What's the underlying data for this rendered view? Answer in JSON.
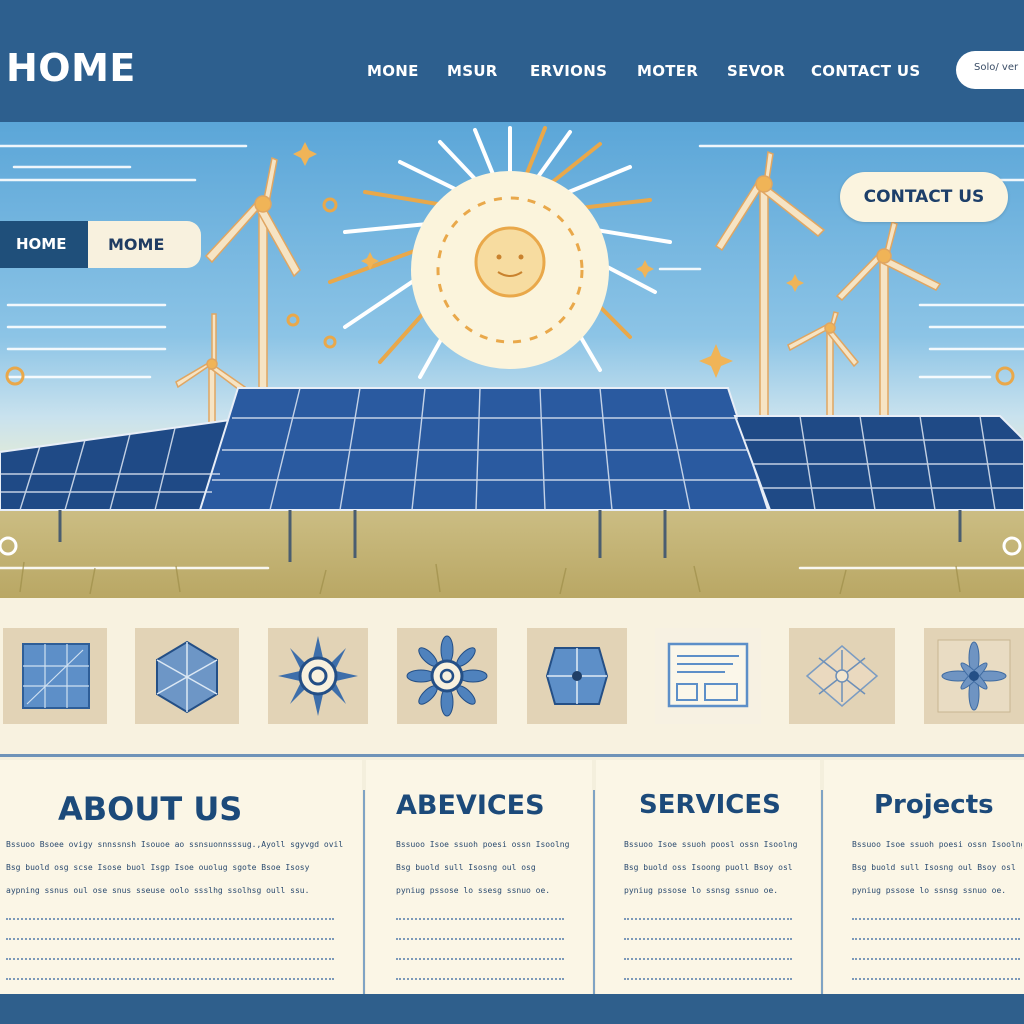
{
  "header": {
    "logo": "HOME",
    "nav": [
      "MONE",
      "MSUR",
      "ERVIONS",
      "MOTER",
      "SEVOR",
      "CONTACT US"
    ],
    "search_placeholder": "Solo/ ver"
  },
  "hero": {
    "breadcrumb": {
      "home": "HOME",
      "current": "MOME"
    },
    "cta": "CONTACT US"
  },
  "features": [
    {
      "icon": "solar-grid-icon"
    },
    {
      "icon": "hexagon-icon"
    },
    {
      "icon": "sun-icon"
    },
    {
      "icon": "sunflower-icon"
    },
    {
      "icon": "panel-joint-icon"
    },
    {
      "icon": "document-icon"
    },
    {
      "icon": "compass-icon"
    },
    {
      "icon": "star-icon"
    }
  ],
  "columns": [
    {
      "title": "ABOUT US",
      "lines": [
        "Bssuoo Bsoee ovigy snnssnsh Isouoe ao ssnsuonnsssug.,Ayoll sgyvgd ovil",
        "Bsg buold osg scse Isose buol Isgp Isoe ouolug sgote Bsoe Isosy",
        "aypning ssnus oul ose snus sseuse oolo ssslhg ssolhsg oull ssu."
      ]
    },
    {
      "title": "ABEVICES",
      "lines": [
        "Bssuoo Isoe ssuoh poesi ossn Isoolng",
        "Bsg buold sull Isosng oul osg",
        "pyniug pssose lo ssesg ssnuo oe."
      ]
    },
    {
      "title": "SERVICES",
      "lines": [
        "Bssuoo Isoe ssuoh poosl ossn Isoolng",
        "Bsg buold oss Isoong puoll Bsoy osl",
        "pyniug pssose lo ssnsg ssnuo oe."
      ]
    },
    {
      "title": "Projects",
      "lines": [
        "Bssuoo Isoe ssuoh poesi ossn Isoolng",
        "Bsg buold sull Isosng oul Bsoy osl",
        "pyniug pssose lo ssnsg ssnuo oe."
      ]
    }
  ],
  "colors": {
    "header_bg": "#2d5f8e",
    "accent_gold": "#e9a84a",
    "navy": "#1c4a7a",
    "cream": "#f8f2e0"
  }
}
